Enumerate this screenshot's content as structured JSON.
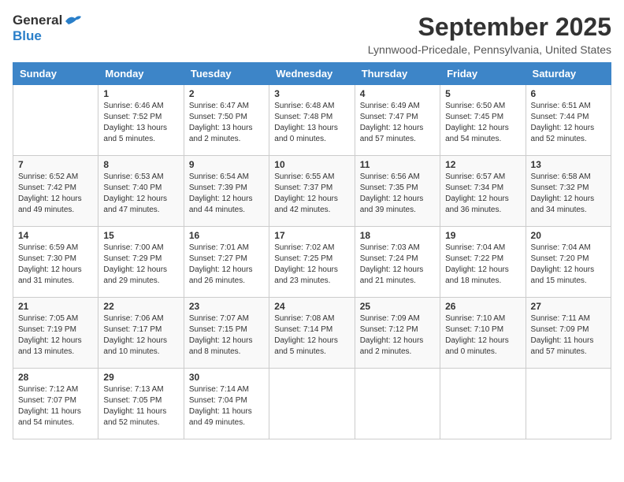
{
  "header": {
    "logo_general": "General",
    "logo_blue": "Blue",
    "month_title": "September 2025",
    "location": "Lynnwood-Pricedale, Pennsylvania, United States"
  },
  "days_of_week": [
    "Sunday",
    "Monday",
    "Tuesday",
    "Wednesday",
    "Thursday",
    "Friday",
    "Saturday"
  ],
  "weeks": [
    [
      {
        "day": "",
        "info": ""
      },
      {
        "day": "1",
        "info": "Sunrise: 6:46 AM\nSunset: 7:52 PM\nDaylight: 13 hours\nand 5 minutes."
      },
      {
        "day": "2",
        "info": "Sunrise: 6:47 AM\nSunset: 7:50 PM\nDaylight: 13 hours\nand 2 minutes."
      },
      {
        "day": "3",
        "info": "Sunrise: 6:48 AM\nSunset: 7:48 PM\nDaylight: 13 hours\nand 0 minutes."
      },
      {
        "day": "4",
        "info": "Sunrise: 6:49 AM\nSunset: 7:47 PM\nDaylight: 12 hours\nand 57 minutes."
      },
      {
        "day": "5",
        "info": "Sunrise: 6:50 AM\nSunset: 7:45 PM\nDaylight: 12 hours\nand 54 minutes."
      },
      {
        "day": "6",
        "info": "Sunrise: 6:51 AM\nSunset: 7:44 PM\nDaylight: 12 hours\nand 52 minutes."
      }
    ],
    [
      {
        "day": "7",
        "info": "Sunrise: 6:52 AM\nSunset: 7:42 PM\nDaylight: 12 hours\nand 49 minutes."
      },
      {
        "day": "8",
        "info": "Sunrise: 6:53 AM\nSunset: 7:40 PM\nDaylight: 12 hours\nand 47 minutes."
      },
      {
        "day": "9",
        "info": "Sunrise: 6:54 AM\nSunset: 7:39 PM\nDaylight: 12 hours\nand 44 minutes."
      },
      {
        "day": "10",
        "info": "Sunrise: 6:55 AM\nSunset: 7:37 PM\nDaylight: 12 hours\nand 42 minutes."
      },
      {
        "day": "11",
        "info": "Sunrise: 6:56 AM\nSunset: 7:35 PM\nDaylight: 12 hours\nand 39 minutes."
      },
      {
        "day": "12",
        "info": "Sunrise: 6:57 AM\nSunset: 7:34 PM\nDaylight: 12 hours\nand 36 minutes."
      },
      {
        "day": "13",
        "info": "Sunrise: 6:58 AM\nSunset: 7:32 PM\nDaylight: 12 hours\nand 34 minutes."
      }
    ],
    [
      {
        "day": "14",
        "info": "Sunrise: 6:59 AM\nSunset: 7:30 PM\nDaylight: 12 hours\nand 31 minutes."
      },
      {
        "day": "15",
        "info": "Sunrise: 7:00 AM\nSunset: 7:29 PM\nDaylight: 12 hours\nand 29 minutes."
      },
      {
        "day": "16",
        "info": "Sunrise: 7:01 AM\nSunset: 7:27 PM\nDaylight: 12 hours\nand 26 minutes."
      },
      {
        "day": "17",
        "info": "Sunrise: 7:02 AM\nSunset: 7:25 PM\nDaylight: 12 hours\nand 23 minutes."
      },
      {
        "day": "18",
        "info": "Sunrise: 7:03 AM\nSunset: 7:24 PM\nDaylight: 12 hours\nand 21 minutes."
      },
      {
        "day": "19",
        "info": "Sunrise: 7:04 AM\nSunset: 7:22 PM\nDaylight: 12 hours\nand 18 minutes."
      },
      {
        "day": "20",
        "info": "Sunrise: 7:04 AM\nSunset: 7:20 PM\nDaylight: 12 hours\nand 15 minutes."
      }
    ],
    [
      {
        "day": "21",
        "info": "Sunrise: 7:05 AM\nSunset: 7:19 PM\nDaylight: 12 hours\nand 13 minutes."
      },
      {
        "day": "22",
        "info": "Sunrise: 7:06 AM\nSunset: 7:17 PM\nDaylight: 12 hours\nand 10 minutes."
      },
      {
        "day": "23",
        "info": "Sunrise: 7:07 AM\nSunset: 7:15 PM\nDaylight: 12 hours\nand 8 minutes."
      },
      {
        "day": "24",
        "info": "Sunrise: 7:08 AM\nSunset: 7:14 PM\nDaylight: 12 hours\nand 5 minutes."
      },
      {
        "day": "25",
        "info": "Sunrise: 7:09 AM\nSunset: 7:12 PM\nDaylight: 12 hours\nand 2 minutes."
      },
      {
        "day": "26",
        "info": "Sunrise: 7:10 AM\nSunset: 7:10 PM\nDaylight: 12 hours\nand 0 minutes."
      },
      {
        "day": "27",
        "info": "Sunrise: 7:11 AM\nSunset: 7:09 PM\nDaylight: 11 hours\nand 57 minutes."
      }
    ],
    [
      {
        "day": "28",
        "info": "Sunrise: 7:12 AM\nSunset: 7:07 PM\nDaylight: 11 hours\nand 54 minutes."
      },
      {
        "day": "29",
        "info": "Sunrise: 7:13 AM\nSunset: 7:05 PM\nDaylight: 11 hours\nand 52 minutes."
      },
      {
        "day": "30",
        "info": "Sunrise: 7:14 AM\nSunset: 7:04 PM\nDaylight: 11 hours\nand 49 minutes."
      },
      {
        "day": "",
        "info": ""
      },
      {
        "day": "",
        "info": ""
      },
      {
        "day": "",
        "info": ""
      },
      {
        "day": "",
        "info": ""
      }
    ]
  ]
}
